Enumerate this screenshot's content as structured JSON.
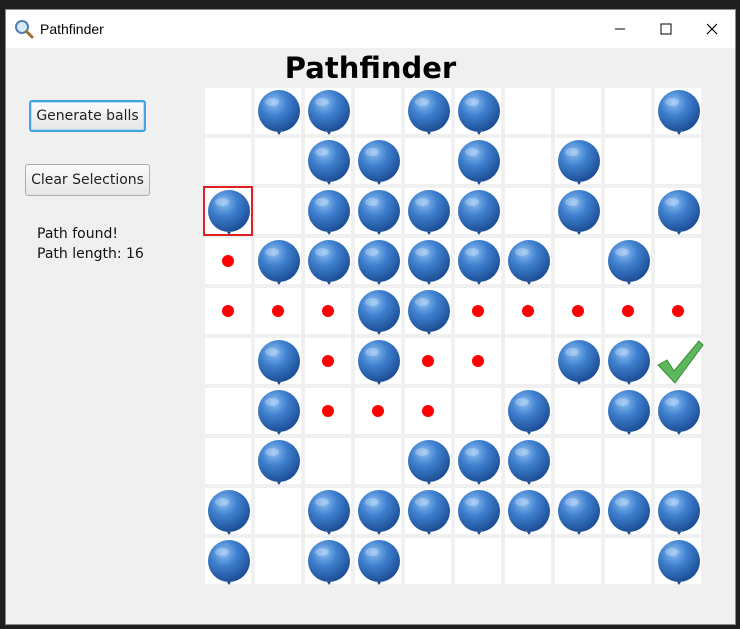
{
  "window": {
    "title": "Pathfinder",
    "icon": "magnifier-icon"
  },
  "heading": "Pathfinder",
  "buttons": {
    "generate": "Generate balls",
    "clear": "Clear Selections"
  },
  "status": {
    "line1": "Path found!",
    "line2": "Path length: 16"
  },
  "colors": {
    "ball": "#3b78c9",
    "path_dot": "#ff0000",
    "selection": "#e02020",
    "goal_check": "#5cb85c"
  },
  "grid": {
    "rows": 10,
    "cols": 10,
    "legend": {
      "B": "ball",
      "P": "path-dot",
      "S": "selected-start-ball",
      "G": "goal-check",
      ".": "empty"
    },
    "cells": [
      ".BB.BB...B",
      "..BB.B.B..",
      "S.BBBB.B.B",
      "PBBBBBB.B.",
      "PPPBBPPPPP",
      ".BPBPP.BBG",
      ".BPPP.B.BB",
      ".B..BBB...",
      "B.BBBBBBBB",
      "B.BB.....B"
    ]
  }
}
